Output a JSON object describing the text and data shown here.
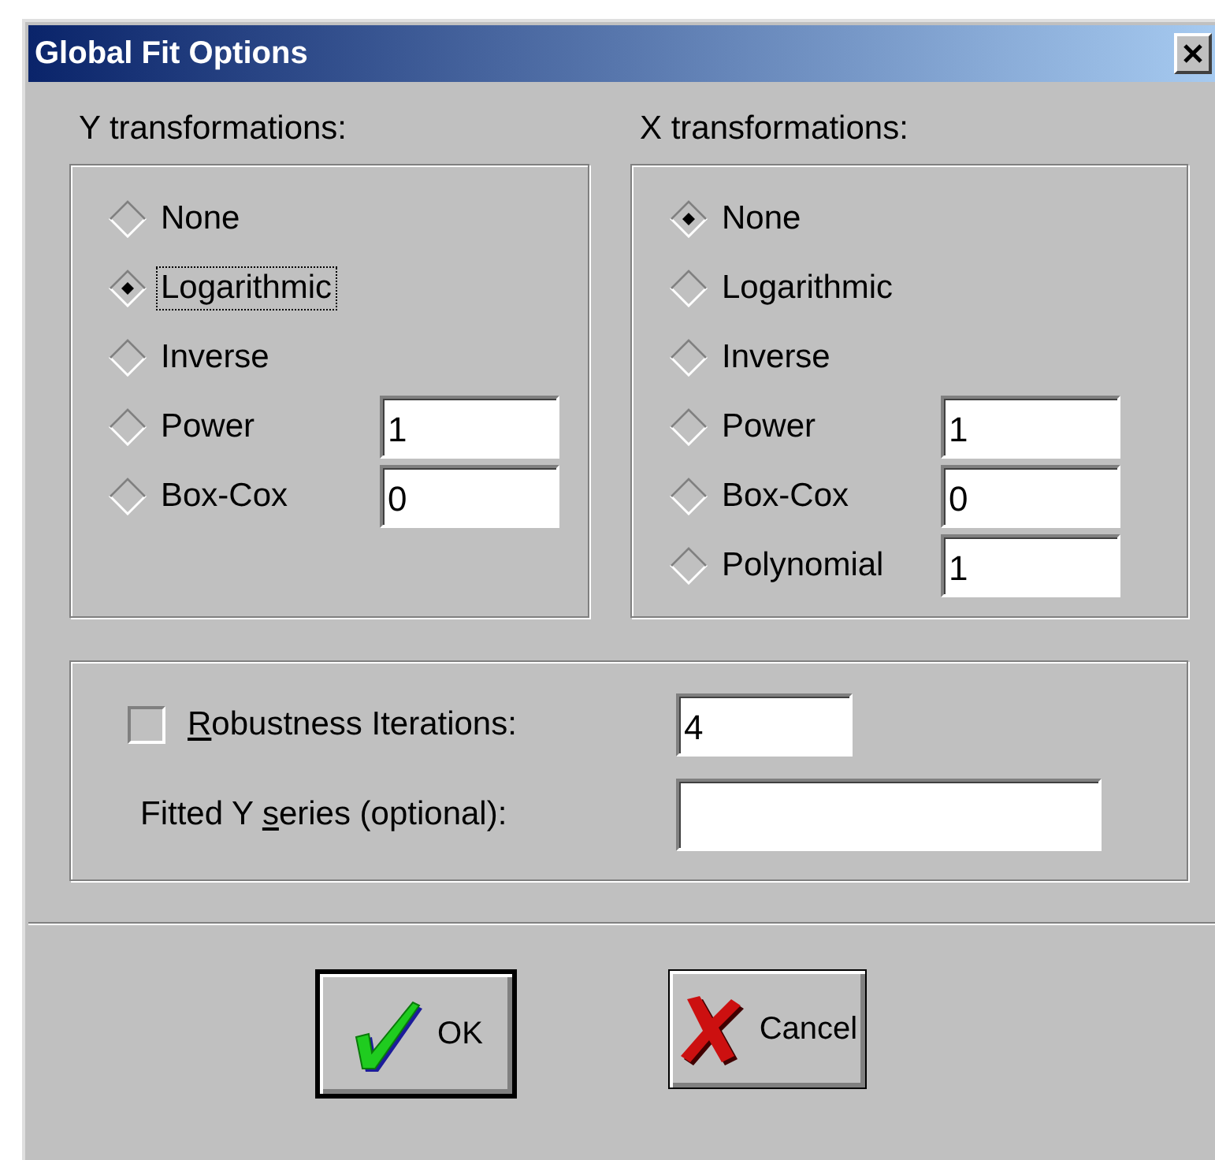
{
  "window": {
    "title": "Global Fit Options"
  },
  "groups": [
    {
      "label": "Y transformations:",
      "options": [
        {
          "label": "None",
          "selected": false,
          "focused": false
        },
        {
          "label": "Logarithmic",
          "selected": true,
          "focused": true
        },
        {
          "label": "Inverse",
          "selected": false,
          "focused": false
        },
        {
          "label": "Power",
          "selected": false,
          "focused": false,
          "value": "1"
        },
        {
          "label": "Box-Cox",
          "selected": false,
          "focused": false,
          "value": "0"
        }
      ]
    },
    {
      "label": "X transformations:",
      "options": [
        {
          "label": "None",
          "selected": true,
          "focused": false
        },
        {
          "label": "Logarithmic",
          "selected": false,
          "focused": false
        },
        {
          "label": "Inverse",
          "selected": false,
          "focused": false
        },
        {
          "label": "Power",
          "selected": false,
          "focused": false,
          "value": "1"
        },
        {
          "label": "Box-Cox",
          "selected": false,
          "focused": false,
          "value": "0"
        },
        {
          "label": "Polynomial",
          "selected": false,
          "focused": false,
          "value": "1"
        }
      ]
    }
  ],
  "robustness": {
    "checked": false,
    "label_key": "R",
    "label_rest": "obustness Iterations:",
    "value": "4"
  },
  "fitted": {
    "label_before": "Fitted Y ",
    "label_key": "s",
    "label_rest": "eries (optional):"
  },
  "buttons": [
    {
      "kind": "ok",
      "label": "OK",
      "default": true
    },
    {
      "kind": "cancel",
      "label": "Cancel",
      "default": false
    }
  ]
}
